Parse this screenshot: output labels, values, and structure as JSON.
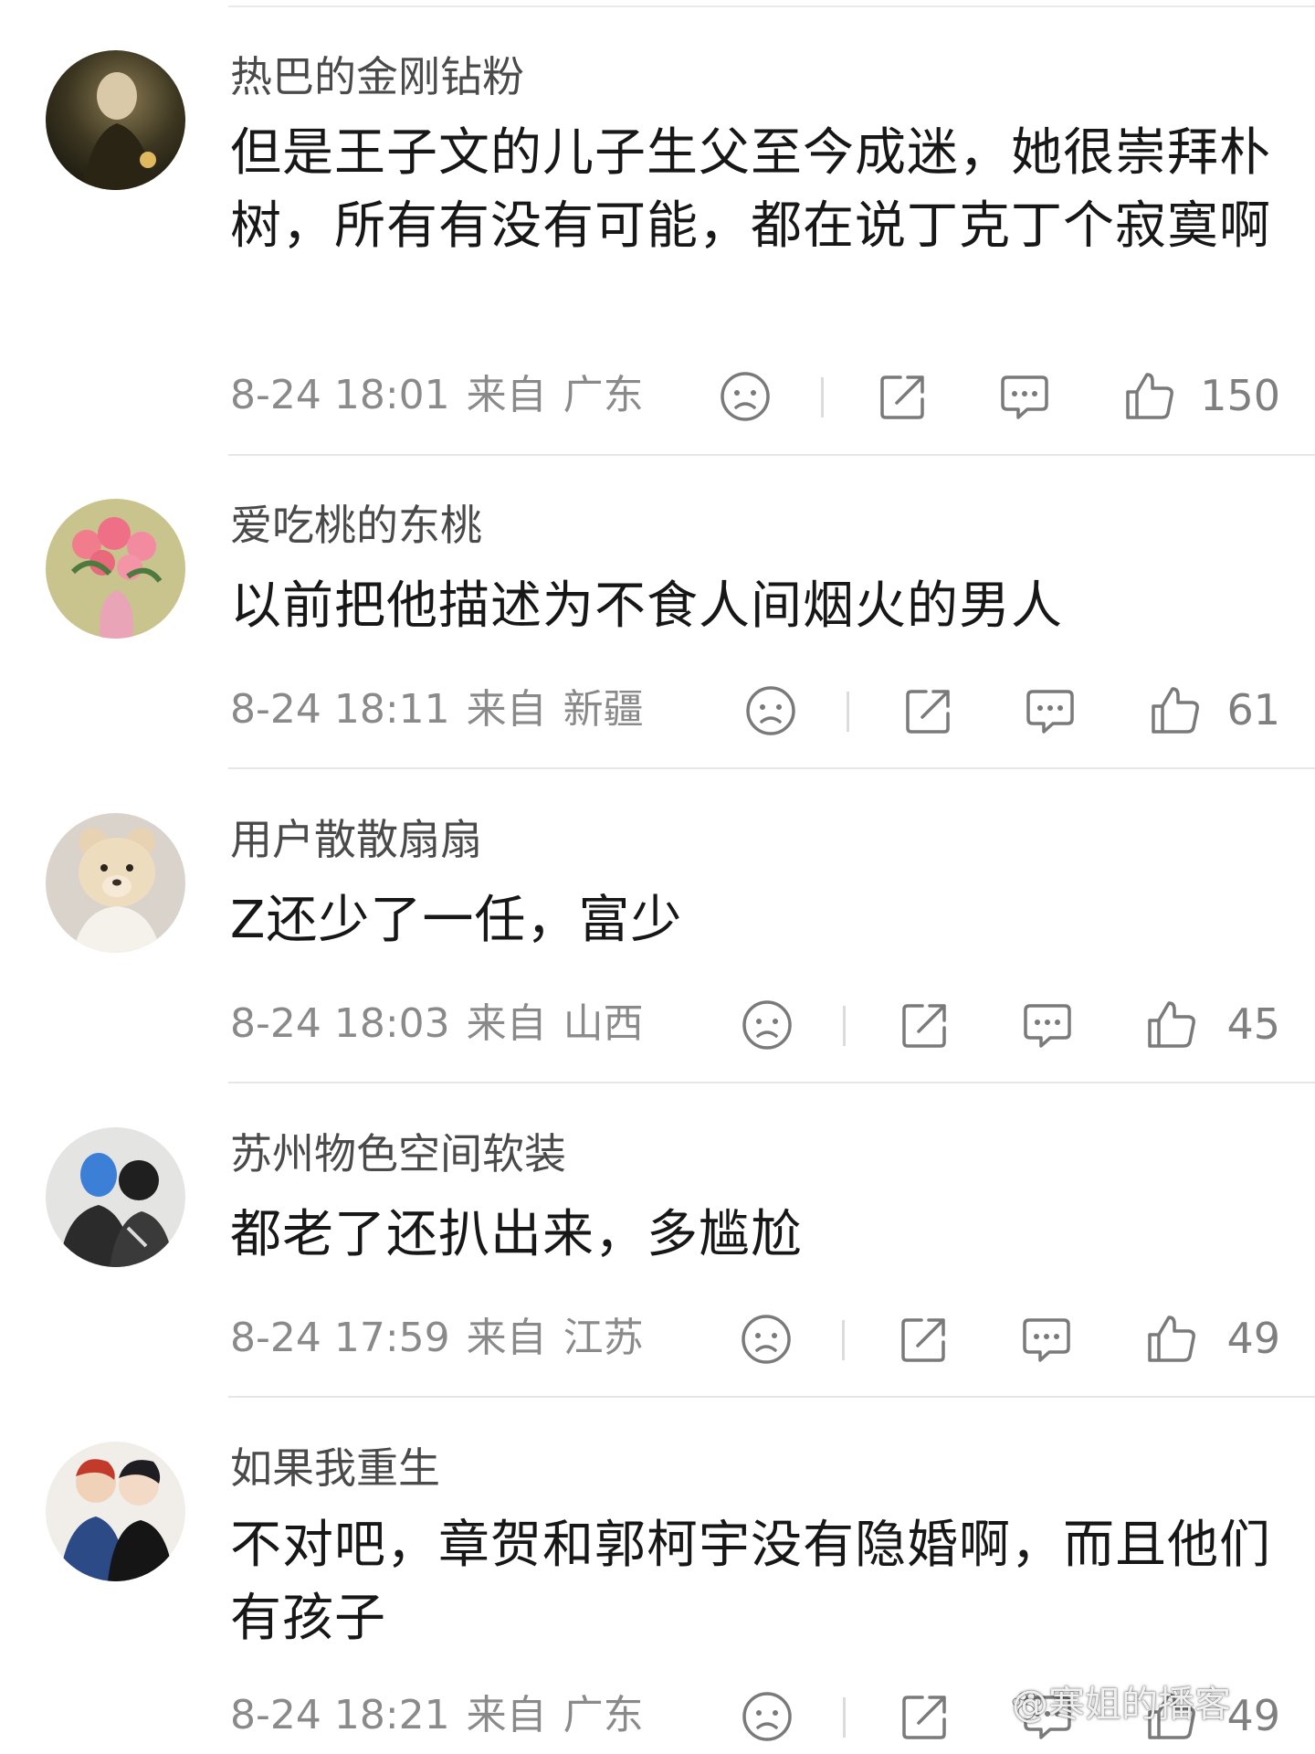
{
  "comments": [
    {
      "username": "热巴的金刚钻粉",
      "text": "但是王子文的儿子生父至今成迷，她很崇拜朴树，所有有没有可能，都在说丁克丁个寂寞啊",
      "time": "8-24 18:01",
      "from_label": "来自",
      "location": "广东",
      "likes": "150",
      "avatar": "portrait-dark-gold"
    },
    {
      "username": "爱吃桃的东桃",
      "text": "以前把他描述为不食人间烟火的男人",
      "time": "8-24 18:11",
      "from_label": "来自",
      "location": "新疆",
      "likes": "61",
      "avatar": "pink-flowers-vase"
    },
    {
      "username": "用户散散扇扇",
      "text": "Z还少了一任，富少",
      "time": "8-24 18:03",
      "from_label": "来自",
      "location": "山西",
      "likes": "45",
      "avatar": "teddy-bear"
    },
    {
      "username": "苏州物色空间软装",
      "text": "都老了还扒出来，多尴尬",
      "time": "8-24 17:59",
      "from_label": "来自",
      "location": "江苏",
      "likes": "49",
      "avatar": "couple-sketch"
    },
    {
      "username": "如果我重生",
      "text": "不对吧，章贺和郭柯宇没有隐婚啊，而且他们有孩子",
      "time": "8-24 18:21",
      "from_label": "来自",
      "location": "广东",
      "likes": "49",
      "avatar": "anime-boys"
    }
  ],
  "icons": {
    "dislike": "sad-face-icon",
    "share": "share-icon",
    "reply": "comment-bubble-icon",
    "like": "thumbs-up-icon"
  },
  "colors": {
    "text": "#171717",
    "username": "#4a4a4a",
    "meta": "#8a8a8a",
    "icon": "#7a7a7a",
    "divider": "#e6e6e6"
  },
  "watermark": "@寒姐的播客"
}
